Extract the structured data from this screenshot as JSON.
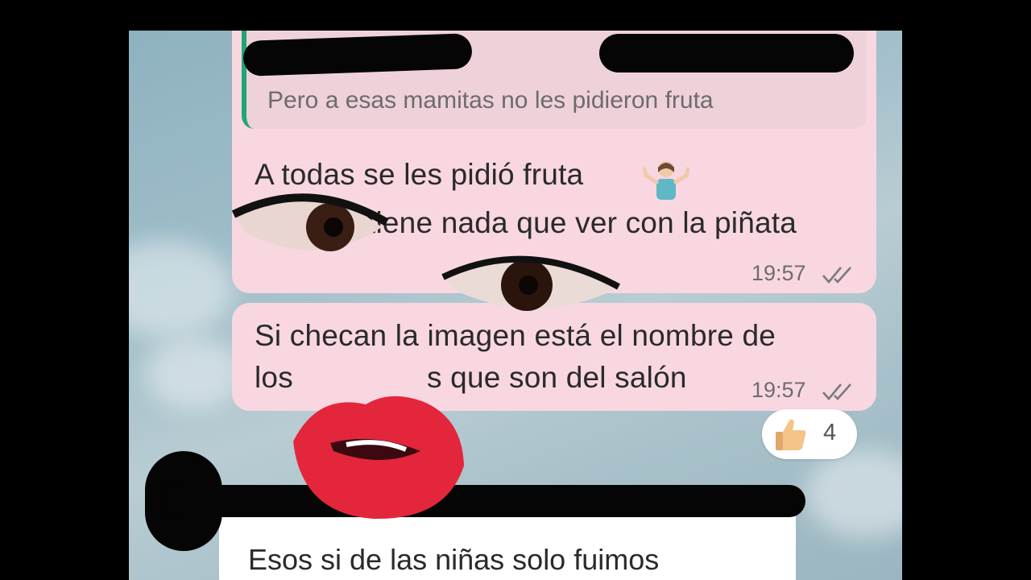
{
  "chat": {
    "quoted_message": "Pero a esas mamitas no les pidieron fruta",
    "messages": [
      {
        "lines": [
          "A todas se les pidió fruta",
          "tiene nada que ver con la piñata"
        ],
        "time": "19:57",
        "status": "read"
      },
      {
        "lines": [
          "Si checan la imagen está el nombre de",
          "los",
          "s que son del salón"
        ],
        "time": "19:57",
        "status": "read",
        "reaction": {
          "emoji": "thumbs-up",
          "count": "4"
        }
      }
    ],
    "incoming_message": "Esos si de las niñas solo fuimos"
  },
  "overlays": [
    "eye-sticker",
    "eye-sticker",
    "lips-sticker",
    "redaction-marks"
  ],
  "colors": {
    "outgoing_bubble": "#f8d7e1",
    "quote_accent": "#20a676",
    "incoming_bubble": "#ffffff",
    "background": "#000000"
  }
}
